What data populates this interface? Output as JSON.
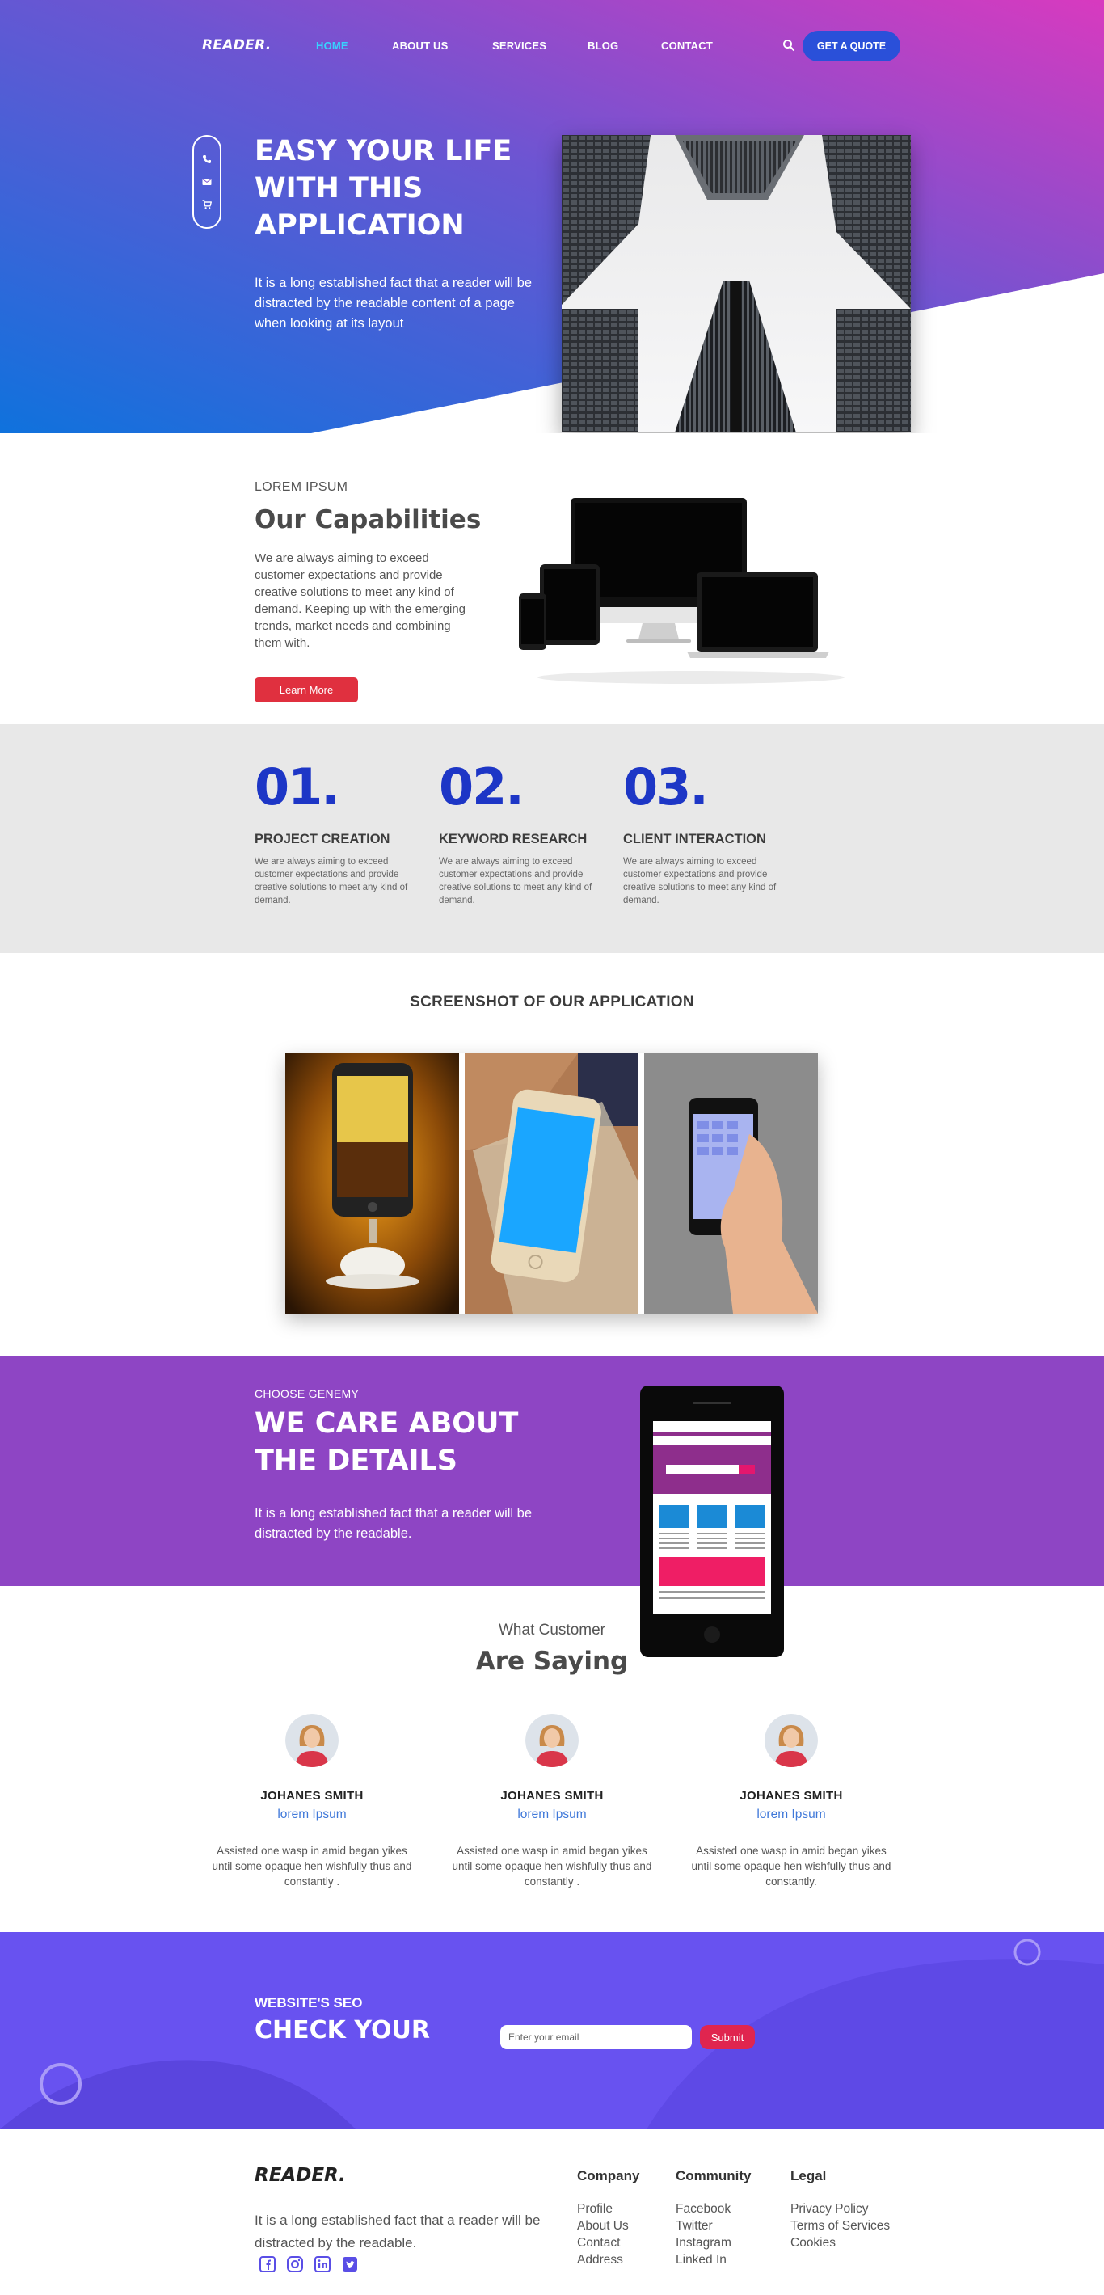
{
  "colors": {
    "hero_gradient_start": "#1271dc",
    "hero_gradient_end": "#d43bbf",
    "accent_blue": "#2a50d9",
    "nav_active": "#37d3ff",
    "step_number": "#1d36c6",
    "cta_red": "#e0303f",
    "care_purple": "#8e45c4",
    "newsletter_purple": "#6852f0",
    "role_blue": "#3f78d9"
  },
  "nav": {
    "logo": "READER.",
    "links": [
      "HOME",
      "ABOUT US",
      "SERVICES",
      "BLOG",
      "CONTACT"
    ],
    "active": "HOME",
    "search_icon": "search-icon",
    "cta": "GET A QUOTE"
  },
  "hero": {
    "side_icons": [
      "phone-icon",
      "mail-icon",
      "cart-icon"
    ],
    "title": "EASY YOUR LIFE WITH THIS APPLICATION",
    "text": "It is a long established fact that a reader will be distracted by the readable content of a page when looking at its layout"
  },
  "capabilities": {
    "eyebrow": "LOREM IPSUM",
    "title": "Our Capabilities",
    "text": "We are always aiming to exceed customer expectations and provide creative solutions to meet any kind of demand. Keeping up with the emerging trends, market needs and combining them with.",
    "button": "Learn More"
  },
  "steps": [
    {
      "number": "01.",
      "title": "PROJECT CREATION",
      "text": "We are always aiming to exceed customer expectations and provide creative solutions to meet any kind of demand."
    },
    {
      "number": "02.",
      "title": "KEYWORD RESEARCH",
      "text": "We are always aiming to exceed customer expectations and provide creative solutions to meet any kind of demand."
    },
    {
      "number": "03.",
      "title": "CLIENT INTERACTION",
      "text": "We are always aiming to exceed customer expectations and provide creative solutions to meet any kind of demand."
    }
  ],
  "screenshots": {
    "title": "SCREENSHOT OF OUR APPLICATION"
  },
  "care": {
    "eyebrow": "CHOOSE GENEMY",
    "title": "WE CARE ABOUT THE DETAILS",
    "text": "It is a long established fact that a reader will be distracted by the readable."
  },
  "testimonials": {
    "subtitle": "What Customer",
    "title": "Are Saying",
    "items": [
      {
        "name": "JOHANES SMITH",
        "role": "lorem Ipsum",
        "text": "Assisted one wasp in amid began yikes until some opaque hen wishfully thus and constantly ."
      },
      {
        "name": "JOHANES SMITH",
        "role": "lorem Ipsum",
        "text": "Assisted one wasp in amid began yikes until some opaque hen wishfully thus and constantly ."
      },
      {
        "name": "JOHANES SMITH",
        "role": "lorem Ipsum",
        "text": "Assisted one wasp in amid began yikes until some opaque hen wishfully thus and constantly."
      }
    ]
  },
  "newsletter": {
    "eyebrow": "WEBSITE'S SEO",
    "title": "CHECK YOUR",
    "placeholder": "Enter your email",
    "button": "Submit"
  },
  "footer": {
    "logo": "READER.",
    "text": "It is a long established fact that a reader will be distracted by the readable.",
    "socials": [
      "facebook-icon",
      "instagram-icon",
      "linkedin-icon",
      "twitter-icon"
    ],
    "columns": [
      {
        "title": "Company",
        "links": [
          "Profile",
          "About Us",
          "Contact",
          "Address"
        ]
      },
      {
        "title": "Community",
        "links": [
          "Facebook",
          "Twitter",
          "Instagram",
          "Linked In"
        ]
      },
      {
        "title": "Legal",
        "links": [
          "Privacy Policy",
          "Terms of Services",
          "Cookies"
        ]
      }
    ]
  }
}
